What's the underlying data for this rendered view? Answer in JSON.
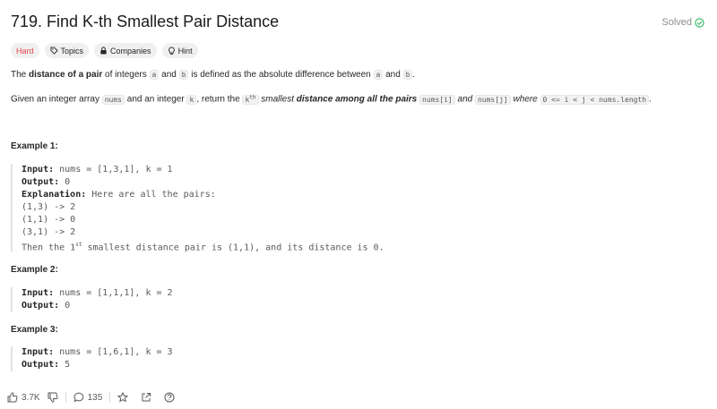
{
  "problem": {
    "title": "719. Find K-th Smallest Pair Distance",
    "status": "Solved"
  },
  "tags": [
    {
      "label": "Hard",
      "icon": ""
    },
    {
      "label": "Topics",
      "icon": "tag-icon"
    },
    {
      "label": "Companies",
      "icon": "lock-icon"
    },
    {
      "label": "Hint",
      "icon": "lightbulb-icon"
    }
  ],
  "description": {
    "p1_pre": "The ",
    "p1_bold": "distance of a pair",
    "p1_mid1": " of integers ",
    "p1_code_a": "a",
    "p1_mid2": " and ",
    "p1_code_b": "b",
    "p1_mid3": " is defined as the absolute difference between ",
    "p1_code_a2": "a",
    "p1_mid4": " and ",
    "p1_code_b2": "b",
    "p1_end": ".",
    "p2_pre": "Given an integer array ",
    "p2_code_nums": "nums",
    "p2_mid1": " and an integer ",
    "p2_code_k": "k",
    "p2_mid2": ", return the ",
    "p2_code_kth": "k",
    "p2_sup": "th",
    "p2_italic": " smallest ",
    "p2_bolditalic": "distance among all the pairs",
    "p2_code_numsi": "nums[i]",
    "p2_mid3": " and ",
    "p2_code_numsj": "nums[j]",
    "p2_mid4": " where ",
    "p2_code_cond": "0 <= i < j < nums.length",
    "p2_end": "."
  },
  "examples": [
    {
      "title": "Example 1:",
      "input_label": "Input:",
      "input": " nums = [1,3,1], k = 1",
      "output_label": "Output:",
      "output": " 0",
      "explanation_label": "Explanation:",
      "explanation": " Here are all the pairs:",
      "lines": [
        "(1,3) -> 2",
        "(1,1) -> 0",
        "(3,1) -> 2"
      ],
      "final_pre": "Then the 1",
      "final_sup": "st",
      "final_post": " smallest distance pair is (1,1), and its distance is 0."
    },
    {
      "title": "Example 2:",
      "input_label": "Input:",
      "input": " nums = [1,1,1], k = 2",
      "output_label": "Output:",
      "output": " 0"
    },
    {
      "title": "Example 3:",
      "input_label": "Input:",
      "input": " nums = [1,6,1], k = 3",
      "output_label": "Output:",
      "output": " 5"
    }
  ],
  "footer": {
    "likes": "3.7K",
    "comments": "135"
  },
  "colors": {
    "solved_green": "#2db55d",
    "hard_red": "#e0454c"
  }
}
